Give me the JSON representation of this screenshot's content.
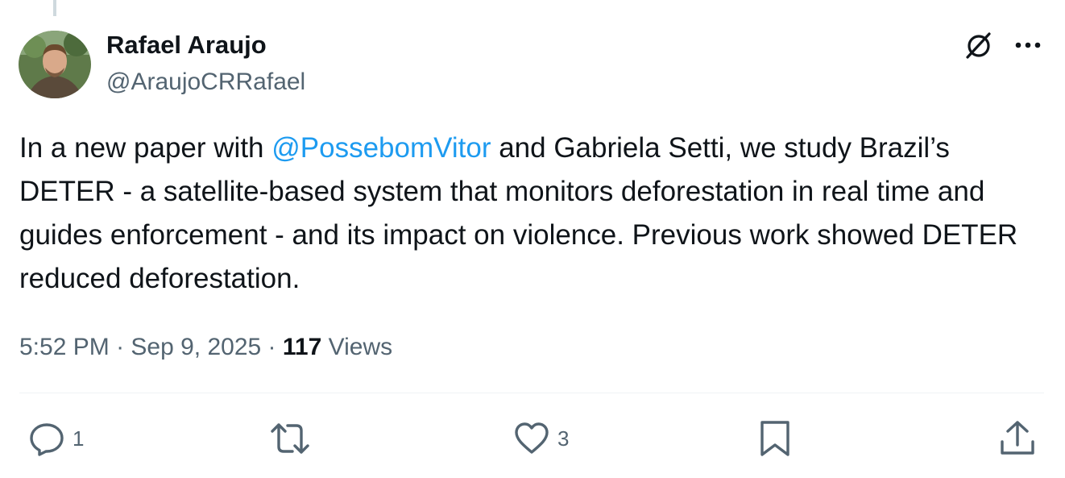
{
  "author": {
    "name": "Rafael Araujo",
    "handle": "@AraujoCRRafael"
  },
  "tweet": {
    "text_before_mention": "In a new paper with ",
    "mention": "@PossebomVitor",
    "text_after_mention": " and Gabriela Setti, we study Brazil’s DETER - a satellite-based system that monitors deforestation in real time and guides enforcement - and its impact on violence. Previous work showed DETER reduced deforestation."
  },
  "meta": {
    "time": "5:52 PM",
    "separator": " · ",
    "date": "Sep 9, 2025",
    "views_count": "117",
    "views_label": " Views"
  },
  "actions": {
    "reply_count": "1",
    "retweet_count": "",
    "like_count": "3"
  },
  "icons": {
    "header": [
      "grok-icon",
      "more-icon"
    ],
    "actions": [
      "reply-icon",
      "retweet-icon",
      "like-icon",
      "bookmark-icon",
      "share-icon"
    ]
  },
  "colors": {
    "text": "#0f1419",
    "secondary": "#536471",
    "link": "#1d9bf0",
    "divider": "#eff3f4"
  }
}
